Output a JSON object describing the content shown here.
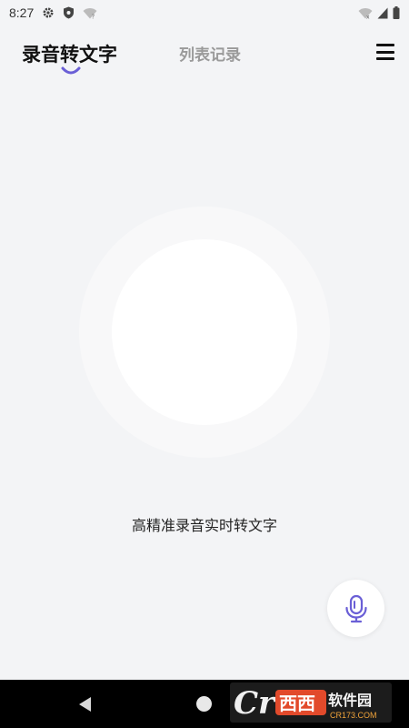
{
  "status_bar": {
    "time": "8:27"
  },
  "header": {
    "tab_active": "录音转文字",
    "tab_inactive": "列表记录"
  },
  "main": {
    "caption": "高精准录音实时转文字"
  },
  "watermark": {
    "brand": "西西软件园",
    "site": "CR173.COM"
  },
  "colors": {
    "accent": "#6a5fd6",
    "background": "#f3f4f6",
    "wave_start": "#c49cf0",
    "wave_end": "#7fd8ea"
  },
  "icons": [
    "settings-icon",
    "shield-icon",
    "wifi-question-icon",
    "wifi-x-icon",
    "signal-icon",
    "battery-icon",
    "menu-icon",
    "sound-wave-icon",
    "microphone-icon",
    "back-icon",
    "home-icon"
  ]
}
